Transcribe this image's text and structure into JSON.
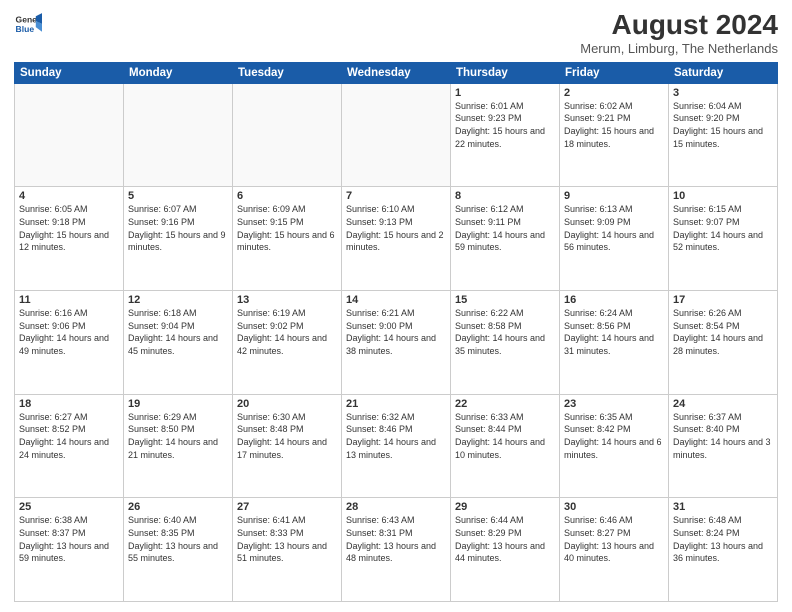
{
  "header": {
    "logo_line1": "General",
    "logo_line2": "Blue",
    "main_title": "August 2024",
    "sub_title": "Merum, Limburg, The Netherlands"
  },
  "days_of_week": [
    "Sunday",
    "Monday",
    "Tuesday",
    "Wednesday",
    "Thursday",
    "Friday",
    "Saturday"
  ],
  "weeks": [
    [
      {
        "day": "",
        "info": ""
      },
      {
        "day": "",
        "info": ""
      },
      {
        "day": "",
        "info": ""
      },
      {
        "day": "",
        "info": ""
      },
      {
        "day": "1",
        "info": "Sunrise: 6:01 AM\nSunset: 9:23 PM\nDaylight: 15 hours\nand 22 minutes."
      },
      {
        "day": "2",
        "info": "Sunrise: 6:02 AM\nSunset: 9:21 PM\nDaylight: 15 hours\nand 18 minutes."
      },
      {
        "day": "3",
        "info": "Sunrise: 6:04 AM\nSunset: 9:20 PM\nDaylight: 15 hours\nand 15 minutes."
      }
    ],
    [
      {
        "day": "4",
        "info": "Sunrise: 6:05 AM\nSunset: 9:18 PM\nDaylight: 15 hours\nand 12 minutes."
      },
      {
        "day": "5",
        "info": "Sunrise: 6:07 AM\nSunset: 9:16 PM\nDaylight: 15 hours\nand 9 minutes."
      },
      {
        "day": "6",
        "info": "Sunrise: 6:09 AM\nSunset: 9:15 PM\nDaylight: 15 hours\nand 6 minutes."
      },
      {
        "day": "7",
        "info": "Sunrise: 6:10 AM\nSunset: 9:13 PM\nDaylight: 15 hours\nand 2 minutes."
      },
      {
        "day": "8",
        "info": "Sunrise: 6:12 AM\nSunset: 9:11 PM\nDaylight: 14 hours\nand 59 minutes."
      },
      {
        "day": "9",
        "info": "Sunrise: 6:13 AM\nSunset: 9:09 PM\nDaylight: 14 hours\nand 56 minutes."
      },
      {
        "day": "10",
        "info": "Sunrise: 6:15 AM\nSunset: 9:07 PM\nDaylight: 14 hours\nand 52 minutes."
      }
    ],
    [
      {
        "day": "11",
        "info": "Sunrise: 6:16 AM\nSunset: 9:06 PM\nDaylight: 14 hours\nand 49 minutes."
      },
      {
        "day": "12",
        "info": "Sunrise: 6:18 AM\nSunset: 9:04 PM\nDaylight: 14 hours\nand 45 minutes."
      },
      {
        "day": "13",
        "info": "Sunrise: 6:19 AM\nSunset: 9:02 PM\nDaylight: 14 hours\nand 42 minutes."
      },
      {
        "day": "14",
        "info": "Sunrise: 6:21 AM\nSunset: 9:00 PM\nDaylight: 14 hours\nand 38 minutes."
      },
      {
        "day": "15",
        "info": "Sunrise: 6:22 AM\nSunset: 8:58 PM\nDaylight: 14 hours\nand 35 minutes."
      },
      {
        "day": "16",
        "info": "Sunrise: 6:24 AM\nSunset: 8:56 PM\nDaylight: 14 hours\nand 31 minutes."
      },
      {
        "day": "17",
        "info": "Sunrise: 6:26 AM\nSunset: 8:54 PM\nDaylight: 14 hours\nand 28 minutes."
      }
    ],
    [
      {
        "day": "18",
        "info": "Sunrise: 6:27 AM\nSunset: 8:52 PM\nDaylight: 14 hours\nand 24 minutes."
      },
      {
        "day": "19",
        "info": "Sunrise: 6:29 AM\nSunset: 8:50 PM\nDaylight: 14 hours\nand 21 minutes."
      },
      {
        "day": "20",
        "info": "Sunrise: 6:30 AM\nSunset: 8:48 PM\nDaylight: 14 hours\nand 17 minutes."
      },
      {
        "day": "21",
        "info": "Sunrise: 6:32 AM\nSunset: 8:46 PM\nDaylight: 14 hours\nand 13 minutes."
      },
      {
        "day": "22",
        "info": "Sunrise: 6:33 AM\nSunset: 8:44 PM\nDaylight: 14 hours\nand 10 minutes."
      },
      {
        "day": "23",
        "info": "Sunrise: 6:35 AM\nSunset: 8:42 PM\nDaylight: 14 hours\nand 6 minutes."
      },
      {
        "day": "24",
        "info": "Sunrise: 6:37 AM\nSunset: 8:40 PM\nDaylight: 14 hours\nand 3 minutes."
      }
    ],
    [
      {
        "day": "25",
        "info": "Sunrise: 6:38 AM\nSunset: 8:37 PM\nDaylight: 13 hours\nand 59 minutes."
      },
      {
        "day": "26",
        "info": "Sunrise: 6:40 AM\nSunset: 8:35 PM\nDaylight: 13 hours\nand 55 minutes."
      },
      {
        "day": "27",
        "info": "Sunrise: 6:41 AM\nSunset: 8:33 PM\nDaylight: 13 hours\nand 51 minutes."
      },
      {
        "day": "28",
        "info": "Sunrise: 6:43 AM\nSunset: 8:31 PM\nDaylight: 13 hours\nand 48 minutes."
      },
      {
        "day": "29",
        "info": "Sunrise: 6:44 AM\nSunset: 8:29 PM\nDaylight: 13 hours\nand 44 minutes."
      },
      {
        "day": "30",
        "info": "Sunrise: 6:46 AM\nSunset: 8:27 PM\nDaylight: 13 hours\nand 40 minutes."
      },
      {
        "day": "31",
        "info": "Sunrise: 6:48 AM\nSunset: 8:24 PM\nDaylight: 13 hours\nand 36 minutes."
      }
    ]
  ]
}
